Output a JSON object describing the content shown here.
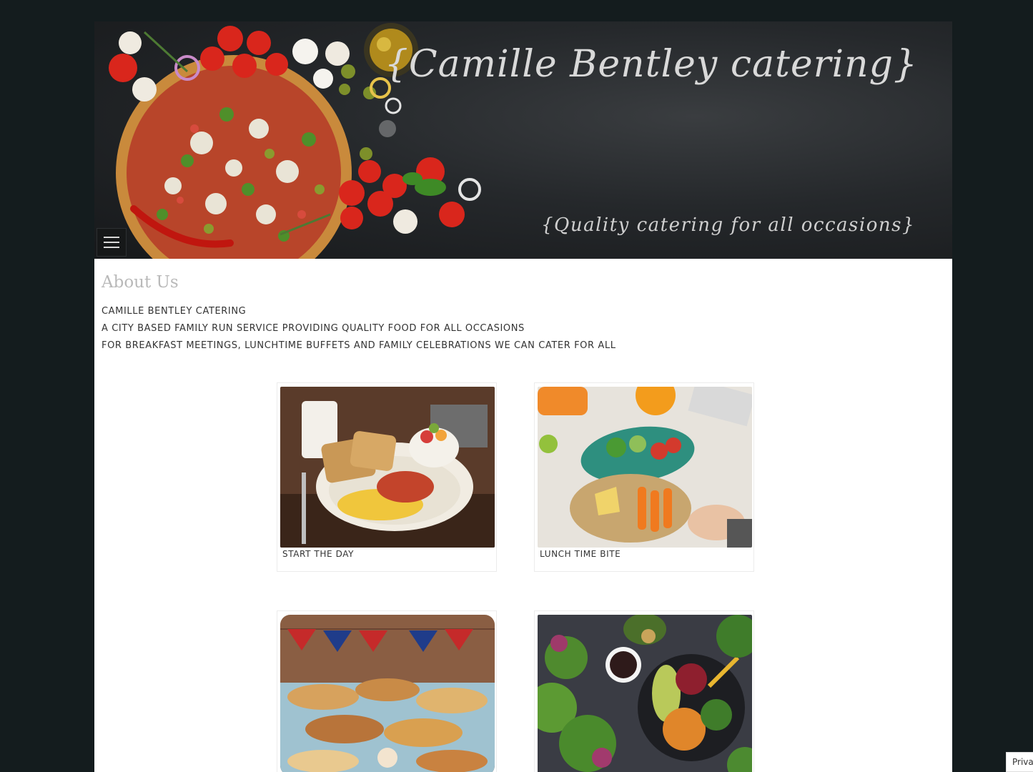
{
  "header": {
    "site_title": "{Camille Bentley catering}",
    "tagline": "{Quality catering for all occasions}",
    "menu_icon": "hamburger-menu-icon"
  },
  "about": {
    "heading": "About Us",
    "lines": [
      "CAMILLE BENTLEY CATERING",
      "A CITY BASED FAMILY RUN SERVICE PROVIDING QUALITY FOOD FOR ALL OCCASIONS",
      "FOR BREAKFAST MEETINGS, LUNCHTIME BUFFETS AND FAMILY CELEBRATIONS WE CAN CATER FOR ALL"
    ]
  },
  "gallery": [
    {
      "caption": "START THE DAY"
    },
    {
      "caption": "LUNCH TIME BITE"
    },
    {
      "caption": ""
    },
    {
      "caption": ""
    }
  ],
  "privacy_tab": "Priva",
  "colors": {
    "background": "#141c1e",
    "banner": "#25282b",
    "content": "#ffffff"
  }
}
